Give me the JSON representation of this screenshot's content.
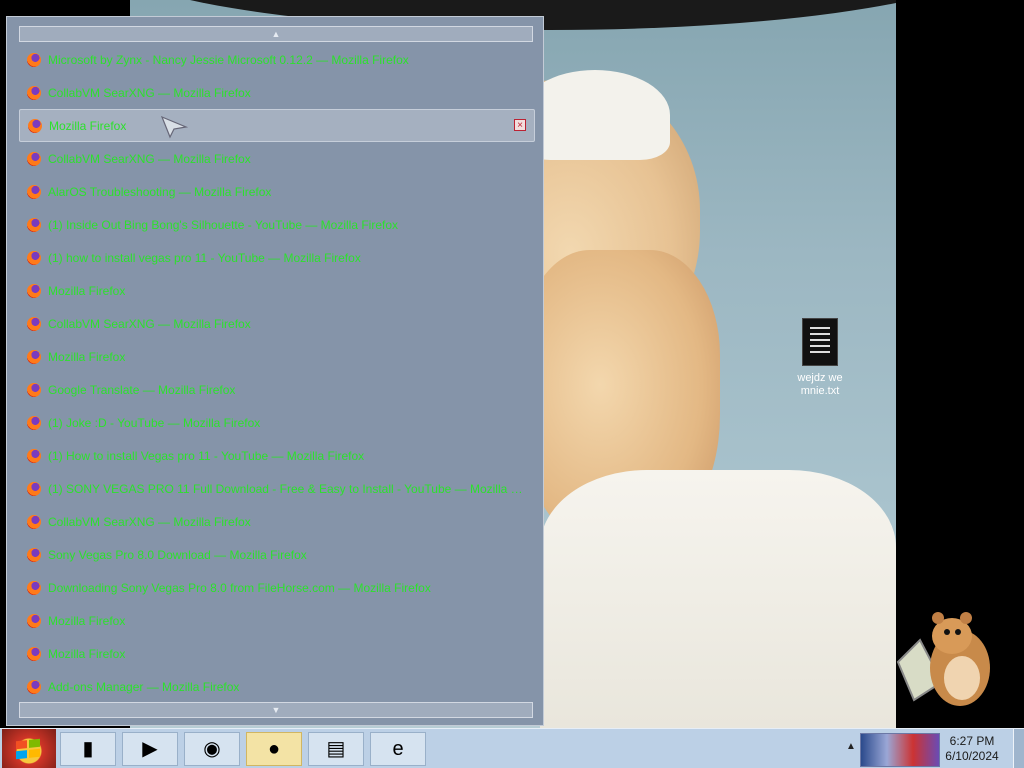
{
  "desktop": {
    "icon_label_line1": "wejdz we",
    "icon_label_line2": "mnie.txt",
    "icon_name": "text-file-icon"
  },
  "switcher": {
    "scroll_up_icon": "▲",
    "scroll_down_icon": "▼",
    "hover_index": 2,
    "items": [
      {
        "label": "Microsoft by Zynx - Nancy Jessie Microsoft 0.12.2 — Mozilla Firefox"
      },
      {
        "label": "CollabVM SearXNG — Mozilla Firefox"
      },
      {
        "label": "Mozilla Firefox"
      },
      {
        "label": "CollabVM SearXNG — Mozilla Firefox"
      },
      {
        "label": "AlarOS Troubleshooting — Mozilla Firefox"
      },
      {
        "label": "(1) Inside Out Bing Bong's Silhouette - YouTube — Mozilla Firefox"
      },
      {
        "label": "(1) how to install vegas pro 11 - YouTube — Mozilla Firefox"
      },
      {
        "label": "Mozilla Firefox"
      },
      {
        "label": "CollabVM SearXNG — Mozilla Firefox"
      },
      {
        "label": "Mozilla Firefox"
      },
      {
        "label": "Google Translate — Mozilla Firefox"
      },
      {
        "label": "(1) Joke :D - YouTube — Mozilla Firefox"
      },
      {
        "label": "(1) How to install Vegas pro 11 - YouTube — Mozilla Firefox"
      },
      {
        "label": "(1) SONY VEGAS PRO 11 Full Download - Free & Easy to Install - YouTube — Mozilla Firefox"
      },
      {
        "label": "CollabVM SearXNG — Mozilla Firefox"
      },
      {
        "label": "Sony Vegas Pro 8.0 Download — Mozilla Firefox"
      },
      {
        "label": "Downloading Sony Vegas Pro 8.0 from FileHorse.com — Mozilla Firefox"
      },
      {
        "label": "Mozilla Firefox"
      },
      {
        "label": "Mozilla Firefox"
      },
      {
        "label": "Add-ons Manager — Mozilla Firefox"
      }
    ],
    "close_glyph": "×"
  },
  "taskbar": {
    "buttons": [
      {
        "name": "cmd-window-button",
        "glyph": "▮",
        "active": false
      },
      {
        "name": "media-player-button",
        "glyph": "▶",
        "active": false
      },
      {
        "name": "globe-app-button",
        "glyph": "◉",
        "active": false
      },
      {
        "name": "firefox-button",
        "glyph": "●",
        "active": true
      },
      {
        "name": "explorer-button",
        "glyph": "▤",
        "active": false
      },
      {
        "name": "internet-explorer-button",
        "glyph": "e",
        "active": false
      }
    ],
    "clock_time": "6:27 PM",
    "clock_date": "6/10/2024",
    "tray_arrow": "▲"
  }
}
